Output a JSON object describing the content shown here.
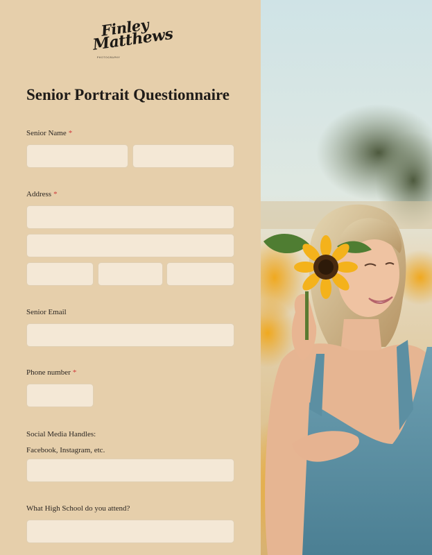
{
  "logo": {
    "line1": "Finley",
    "line2": "Matthews",
    "subtitle": "PHOTOGRAPHY"
  },
  "form": {
    "title": "Senior Portrait Questionnaire",
    "fields": {
      "senior_name": {
        "label": "Senior Name",
        "required": "*"
      },
      "address": {
        "label": "Address",
        "required": "*"
      },
      "senior_email": {
        "label": "Senior Email"
      },
      "phone_number": {
        "label": "Phone number",
        "required": "*"
      },
      "social_media": {
        "label": "Social Media Handles:",
        "sublabel": "Facebook, Instagram, etc."
      },
      "high_school": {
        "label": "What High School do you attend?"
      }
    }
  },
  "photo": {
    "description_icon": "portrait-photo"
  },
  "colors": {
    "panel_background": "#e6cfab",
    "field_background": "#f4e8d6",
    "required_star": "#d0393a"
  }
}
